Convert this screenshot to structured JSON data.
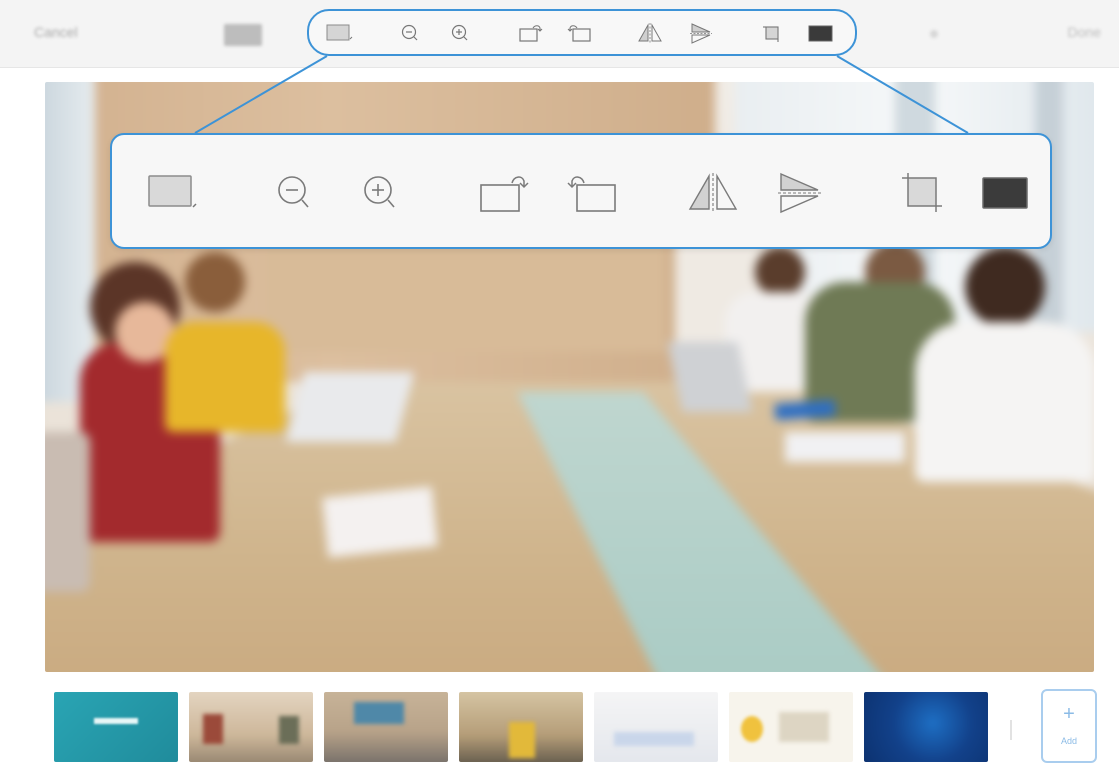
{
  "header": {
    "cancel_label": "Cancel",
    "done_label": "Done"
  },
  "toolbar": {
    "tools": [
      {
        "name": "background-color-icon"
      },
      {
        "name": "zoom-out-icon"
      },
      {
        "name": "zoom-in-icon"
      },
      {
        "name": "rotate-right-icon"
      },
      {
        "name": "rotate-left-icon"
      },
      {
        "name": "flip-horizontal-icon"
      },
      {
        "name": "flip-vertical-icon"
      },
      {
        "name": "crop-icon"
      },
      {
        "name": "fill-frame-icon"
      }
    ],
    "highlight_color": "#3d93d7"
  },
  "thumbnails": [
    {
      "name": "thumb-title-slide",
      "colors": [
        "#2aa6b5",
        "#1f8a9a"
      ]
    },
    {
      "name": "thumb-meeting-room-1",
      "colors": [
        "#d7c6b1",
        "#8f7f6b"
      ]
    },
    {
      "name": "thumb-meeting-room-2",
      "colors": [
        "#b8a389",
        "#6f6a66"
      ]
    },
    {
      "name": "thumb-team-photo",
      "colors": [
        "#c7b48f",
        "#5b5448"
      ]
    },
    {
      "name": "thumb-diagram-slide",
      "colors": [
        "#f2f2f2",
        "#dcdfe6"
      ]
    },
    {
      "name": "thumb-lightbulb-slide",
      "colors": [
        "#f7f4ec",
        "#e5b83a"
      ]
    },
    {
      "name": "thumb-world-map",
      "colors": [
        "#0b2f6b",
        "#1e6fc4"
      ]
    }
  ],
  "add_button": {
    "label": "Add"
  }
}
